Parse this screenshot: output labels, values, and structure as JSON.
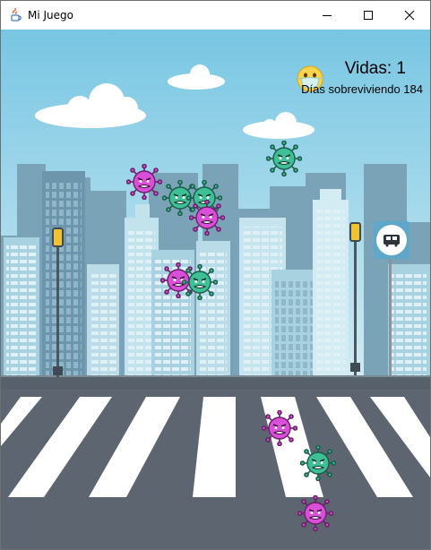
{
  "window": {
    "title": "Mi Juego",
    "app_icon": "java-icon",
    "controls": [
      "minimize-icon",
      "maximize-icon",
      "close-icon"
    ]
  },
  "hud": {
    "lives_text": "Vidas: 1",
    "days_text": "Días sobreviviendo 184"
  },
  "scene": {
    "background": "city-street-with-crosswalk",
    "player": "masked-face-emoji",
    "virus_types": {
      "pink": "#d94fd8",
      "green": "#3fbf96"
    },
    "enemies": [
      {
        "type": "green"
      },
      {
        "type": "pink"
      },
      {
        "type": "green"
      },
      {
        "type": "green"
      },
      {
        "type": "pink"
      },
      {
        "type": "pink"
      },
      {
        "type": "green"
      },
      {
        "type": "pink"
      },
      {
        "type": "green"
      },
      {
        "type": "pink"
      }
    ]
  },
  "colors": {
    "sky_top": "#78c6e3",
    "sky_bottom": "#c8e7f1",
    "building_dark": "#6d96ad",
    "building_light": "#a9d2e0",
    "road": "#5d6670",
    "crosswalk": "#ffffff"
  }
}
